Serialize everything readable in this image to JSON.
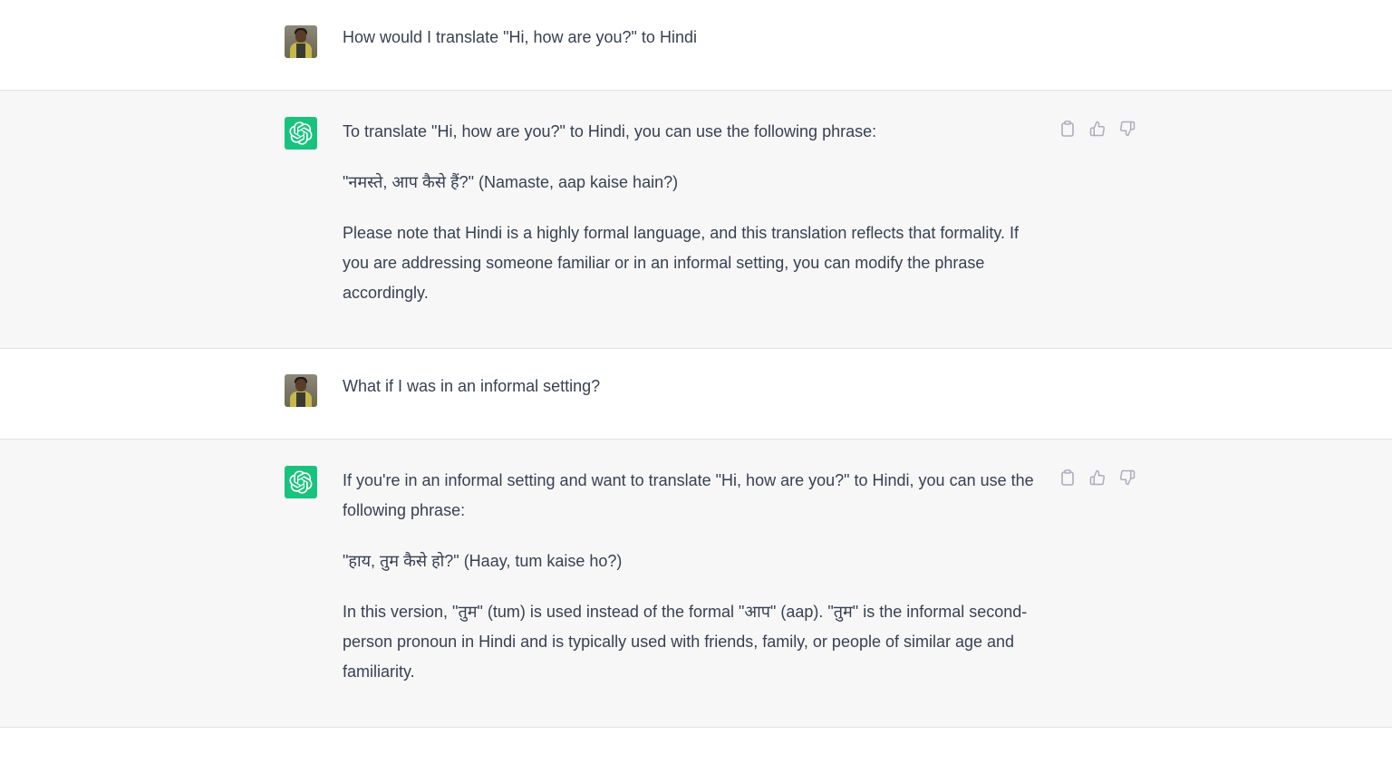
{
  "conversation": [
    {
      "role": "user",
      "avatar": "user-photo",
      "paragraphs": [
        "How would I translate \"Hi, how are you?\" to Hindi"
      ]
    },
    {
      "role": "assistant",
      "avatar": "openai-logo-icon",
      "paragraphs": [
        "To translate \"Hi, how are you?\" to Hindi, you can use the following phrase:",
        "\"नमस्ते, आप कैसे हैं?\" (Namaste, aap kaise hain?)",
        "Please note that Hindi is a highly formal language, and this translation reflects that formality. If you are addressing someone familiar or in an informal setting, you can modify the phrase accordingly."
      ],
      "actions": [
        "copy-icon",
        "thumbs-up-icon",
        "thumbs-down-icon"
      ]
    },
    {
      "role": "user",
      "avatar": "user-photo",
      "paragraphs": [
        "What if I was in an informal setting?"
      ]
    },
    {
      "role": "assistant",
      "avatar": "openai-logo-icon",
      "paragraphs": [
        "If you're in an informal setting and want to translate \"Hi, how are you?\" to Hindi, you can use the following phrase:",
        "\"हाय, तुम कैसे हो?\" (Haay, tum kaise ho?)",
        "In this version, \"तुम\" (tum) is used instead of the formal \"आप\" (aap). \"तुम\" is the informal second-person pronoun in Hindi and is typically used with friends, family, or people of similar age and familiarity."
      ],
      "actions": [
        "copy-icon",
        "thumbs-up-icon",
        "thumbs-down-icon"
      ]
    }
  ],
  "colors": {
    "assistant_bg": "#f7f7f8",
    "user_bg": "#ffffff",
    "bot_avatar": "#19c37d",
    "text": "#374151",
    "icon": "#acacbe"
  }
}
